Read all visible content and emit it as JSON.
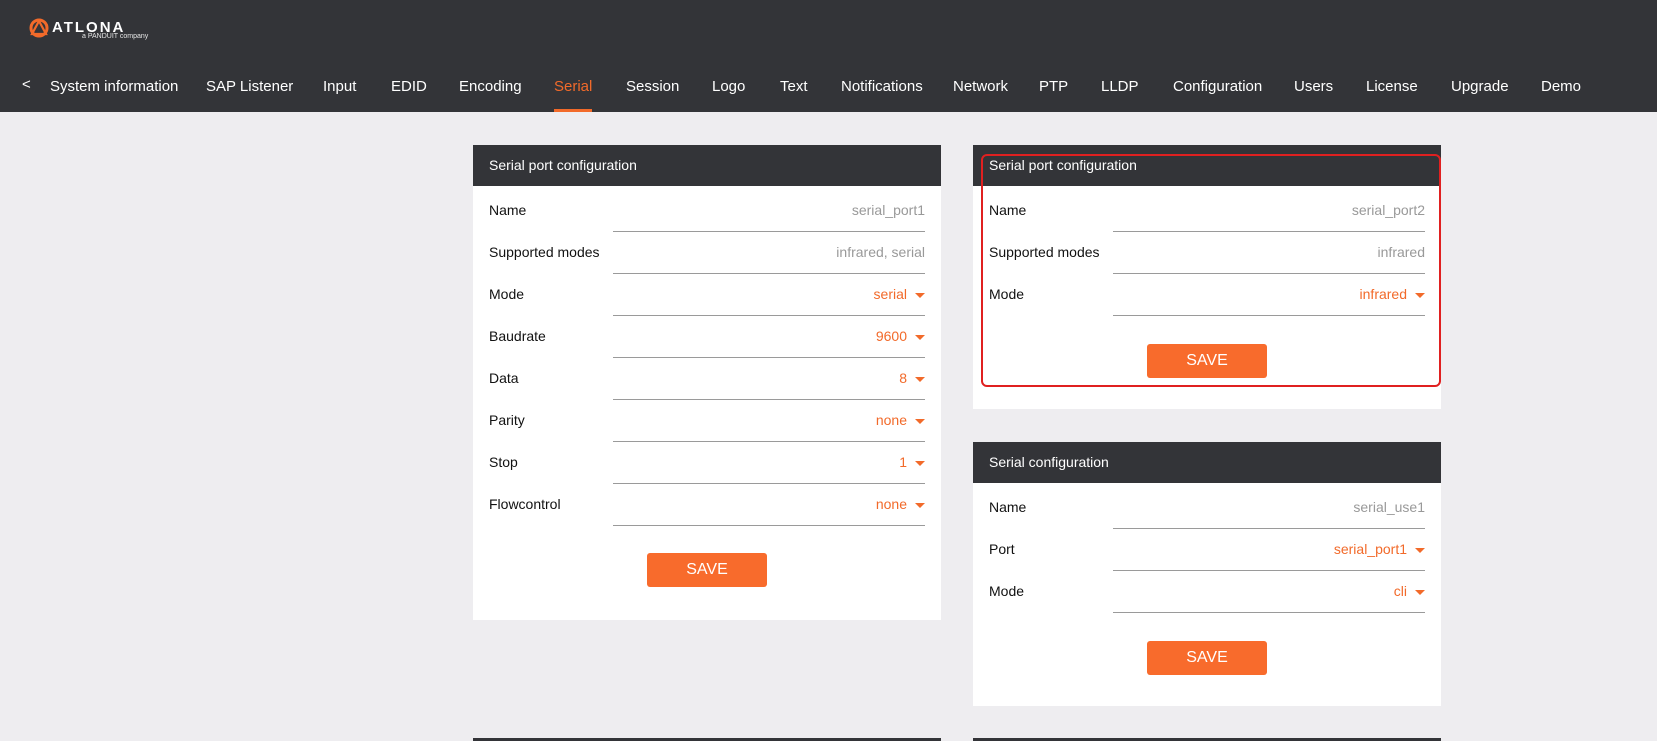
{
  "header": {
    "brand": "ATLONA",
    "brand_sub": "a PANDUIT company",
    "logo_icon": "atlona-logo-icon"
  },
  "nav": {
    "back_label": "<",
    "items": [
      {
        "label": "System information"
      },
      {
        "label": "SAP Listener"
      },
      {
        "label": "Input"
      },
      {
        "label": "EDID"
      },
      {
        "label": "Encoding"
      },
      {
        "label": "Serial"
      },
      {
        "label": "Session"
      },
      {
        "label": "Logo"
      },
      {
        "label": "Text"
      },
      {
        "label": "Notifications"
      },
      {
        "label": "Network"
      },
      {
        "label": "PTP"
      },
      {
        "label": "LLDP"
      },
      {
        "label": "Configuration"
      },
      {
        "label": "Users"
      },
      {
        "label": "License"
      },
      {
        "label": "Upgrade"
      },
      {
        "label": "Demo"
      }
    ],
    "active": "Serial",
    "accent_color": "#f26a2a"
  },
  "panels": {
    "port1": {
      "title": "Serial port configuration",
      "rows": [
        {
          "label": "Name",
          "value": "serial_port1"
        },
        {
          "label": "Supported modes",
          "value": "infrared, serial"
        },
        {
          "label": "Mode",
          "value": "serial"
        },
        {
          "label": "Baudrate",
          "value": "9600"
        },
        {
          "label": "Data",
          "value": "8"
        },
        {
          "label": "Parity",
          "value": "none"
        },
        {
          "label": "Stop",
          "value": "1"
        },
        {
          "label": "Flowcontrol",
          "value": "none"
        }
      ],
      "save_label": "SAVE"
    },
    "port2": {
      "title": "Serial port configuration",
      "rows": [
        {
          "label": "Name",
          "value": "serial_port2"
        },
        {
          "label": "Supported modes",
          "value": "infrared"
        },
        {
          "label": "Mode",
          "value": "infrared"
        }
      ],
      "save_label": "SAVE"
    },
    "serial_config": {
      "title": "Serial configuration",
      "rows": [
        {
          "label": "Name",
          "value": "serial_use1"
        },
        {
          "label": "Port",
          "value": "serial_port1"
        },
        {
          "label": "Mode",
          "value": "cli"
        }
      ],
      "save_label": "SAVE"
    }
  },
  "colors": {
    "header_bg": "#333438",
    "page_bg": "#eeedf0",
    "save_button": "#f86b2c",
    "highlight": "#e02020"
  }
}
